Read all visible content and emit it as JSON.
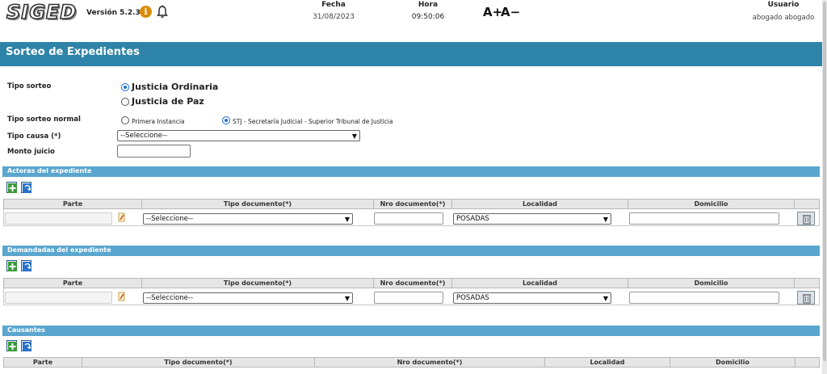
{
  "header": {
    "logo": "SIGED",
    "version": "Versión 5.2.3",
    "info_icon": "info-icon",
    "notifications_icon": "bell-icon",
    "fecha_label": "Fecha",
    "fecha_value": "31/08/2023",
    "hora_label": "Hora",
    "hora_value": "09:50:06",
    "font_increase": "A+",
    "font_decrease": "A−",
    "usuario_label": "Usuario",
    "usuario_value": "abogado abogado"
  },
  "page_title": "Sorteo de Expedientes",
  "form": {
    "tipo_sorteo_label": "Tipo sorteo",
    "tipo_sorteo_options": [
      "Justicia Ordinaria",
      "Justicia de Paz"
    ],
    "tipo_sorteo_selected": "Justicia Ordinaria",
    "tipo_sorteo_normal_label": "Tipo sorteo normal",
    "tipo_sorteo_normal_options": [
      "Primera Instancia",
      "STJ - Secretaría Judicial - Superior Tribunal de Justicia"
    ],
    "tipo_sorteo_normal_selected": "STJ - Secretaría Judicial - Superior Tribunal de Justicia",
    "tipo_causa_label": "Tipo causa (*)",
    "tipo_causa_value": "--Seleccione--",
    "monto_juicio_label": "Monto juicio",
    "monto_juicio_value": ""
  },
  "sections": {
    "actoras": {
      "title": "Actoras del expediente",
      "columns": [
        "Parte",
        "Tipo documento(*)",
        "Nro documento(*)",
        "Localidad",
        "Domicilio",
        ""
      ],
      "row": {
        "parte": "",
        "tipo_documento": "--Seleccione--",
        "nro_documento": "",
        "localidad": "POSADAS",
        "domicilio": ""
      }
    },
    "demandadas": {
      "title": "Demandadas del expediente",
      "columns": [
        "Parte",
        "Tipo documento(*)",
        "Nro documento(*)",
        "Localidad",
        "Domicilio",
        ""
      ],
      "row": {
        "parte": "",
        "tipo_documento": "--Seleccione--",
        "nro_documento": "",
        "localidad": "POSADAS",
        "domicilio": ""
      }
    },
    "causantes": {
      "title": "Causantes",
      "columns": [
        "Parte",
        "Tipo documento(*)",
        "Nro documento(*)",
        "Localidad",
        "Domicilio"
      ]
    }
  },
  "icons": {
    "add": "add-row-icon",
    "refresh": "refresh-icon",
    "edit": "pencil-icon",
    "delete": "trash-icon",
    "dropdown": "chevron-down-icon"
  },
  "colors": {
    "title_bar": "#2e84a8",
    "section_bar": "#5aa6cf",
    "radio_selected": "#1a6fd6"
  }
}
